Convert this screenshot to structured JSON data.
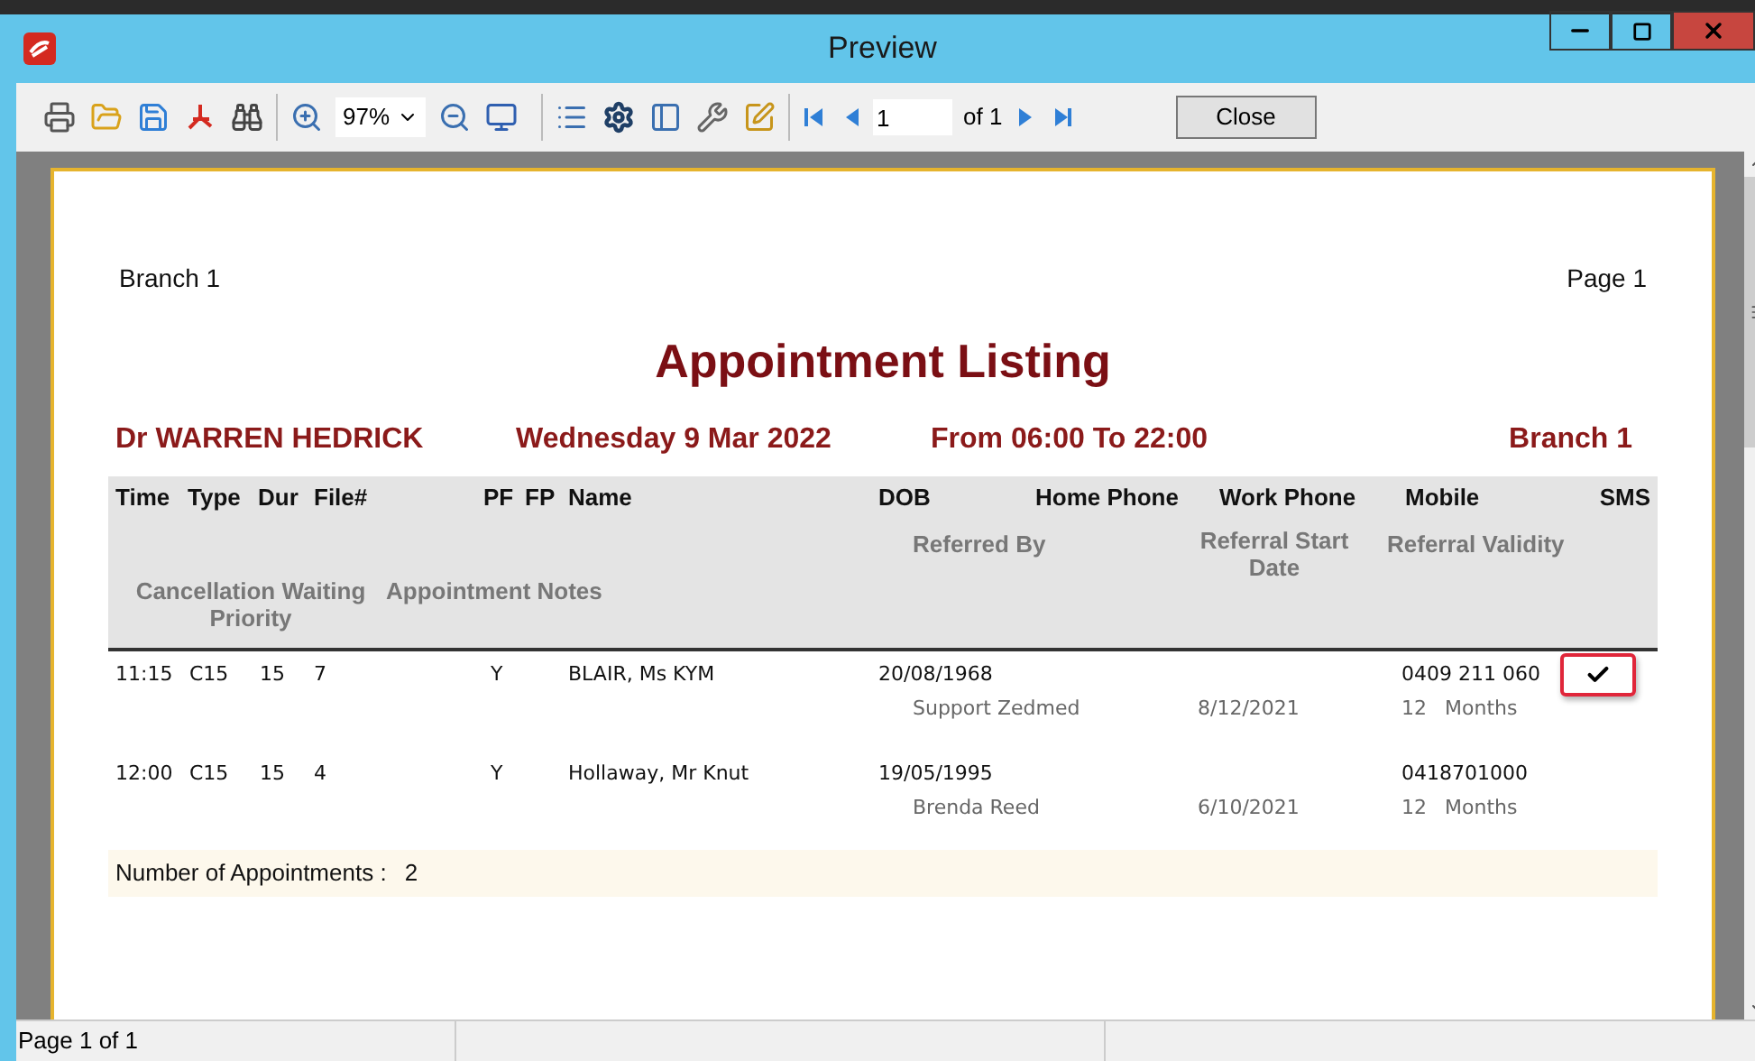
{
  "window": {
    "title": "Preview"
  },
  "toolbar": {
    "zoom": "97%",
    "page_input": "1",
    "page_of": "of 1",
    "close_button": "Close"
  },
  "report": {
    "branch_top": "Branch 1",
    "page_label": "Page 1",
    "title": "Appointment Listing",
    "doctor": "Dr WARREN HEDRICK",
    "date": "Wednesday 9 Mar 2022",
    "time_range": "From 06:00 To 22:00",
    "branch": "Branch 1",
    "header_row_1": [
      "Time",
      "Type",
      "Dur",
      "File#",
      "PF",
      "FP",
      "Name",
      "DOB",
      "Home Phone",
      "Work Phone",
      "Mobile",
      "SMS"
    ],
    "header_row_2": [
      "Referred By",
      "Referral Start Date",
      "Referral Validity"
    ],
    "header_row_3": [
      "Cancellation Waiting Priority",
      "Appointment Notes"
    ],
    "appointments": [
      {
        "time": "11:15",
        "type": "C15",
        "dur": "15",
        "file": "7",
        "pf": "Y",
        "name": "BLAIR, Ms KYM",
        "dob": "20/08/1968",
        "mobile": "0409 211 060",
        "sms": true,
        "highlighted": true,
        "referred_by": "Support Zedmed",
        "referral_start": "8/12/2021",
        "validity_num": "12",
        "validity_unit": "Months"
      },
      {
        "time": "12:00",
        "type": "C15",
        "dur": "15",
        "file": "4",
        "pf": "Y",
        "name": "Hollaway, Mr Knut",
        "dob": "19/05/1995",
        "mobile": "0418701000",
        "sms": false,
        "highlighted": false,
        "referred_by": "Brenda Reed",
        "referral_start": "6/10/2021",
        "validity_num": "12",
        "validity_unit": "Months"
      }
    ],
    "total_label": "Number of Appointments :",
    "total_value": "2"
  },
  "status_bar": {
    "page": "Page 1 of 1"
  }
}
